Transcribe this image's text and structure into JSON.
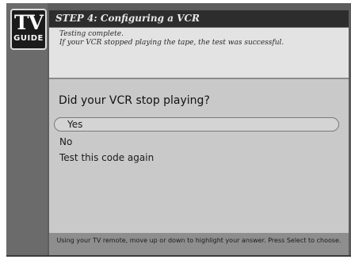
{
  "logo": {
    "top": "TV",
    "bottom": "GUIDE"
  },
  "header": {
    "title": "STEP 4: Configuring a VCR"
  },
  "message": {
    "line1": "Testing complete.",
    "line2": "If your VCR stopped playing the tape, the test was successful."
  },
  "question": "Did your VCR stop playing?",
  "options": [
    {
      "label": "Yes",
      "selected": true
    },
    {
      "label": "No",
      "selected": false
    },
    {
      "label": "Test this code again",
      "selected": false
    }
  ],
  "footer": {
    "hint": "Using your TV remote, move up or down to highlight your answer. Press Select to choose."
  }
}
